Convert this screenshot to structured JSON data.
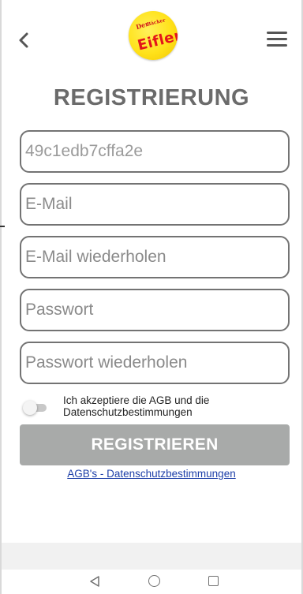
{
  "header": {
    "back_icon": "chevron-left-icon",
    "menu_icon": "hamburger-menu-icon",
    "logo": {
      "line1": "Der",
      "line2": "Bäcker",
      "line3": "Eifler"
    }
  },
  "page_title": "REGISTRIERUNG",
  "form": {
    "fields": [
      {
        "name": "code",
        "value": "",
        "placeholder": "49c1edb7cffa2e"
      },
      {
        "name": "email",
        "value": "",
        "placeholder": "E-Mail"
      },
      {
        "name": "email_repeat",
        "value": "",
        "placeholder": "E-Mail wiederholen"
      },
      {
        "name": "password",
        "value": "",
        "placeholder": "Passwort"
      },
      {
        "name": "password_repeat",
        "value": "",
        "placeholder": "Passwort wiederholen"
      }
    ],
    "consent_text": "Ich akzeptiere die AGB und die Datenschutzbestimmungen",
    "consent_checked": false,
    "submit_label": "REGISTRIEREN",
    "legal_link": "AGB's - Datenschutzbestimmungen"
  },
  "colors": {
    "title": "#6b6b6b",
    "field_border": "#737373",
    "button_bg": "#a8aaa9",
    "link": "#1d3fa8",
    "logo_yellow": "#ffe21a",
    "logo_red": "#e3141a"
  },
  "system_nav": {
    "back_icon": "nav-back-triangle-icon",
    "home_icon": "nav-home-circle-icon",
    "recents_icon": "nav-recents-square-icon"
  }
}
